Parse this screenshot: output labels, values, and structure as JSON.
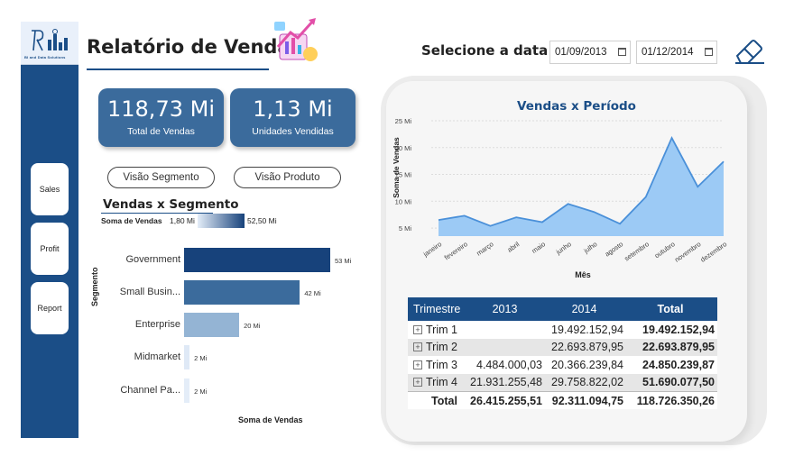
{
  "header": {
    "title": "Relatório de Vendas"
  },
  "sidebar": {
    "logo_text": "BI and Data Solutions",
    "items": [
      {
        "label": "Sales"
      },
      {
        "label": "Profit"
      },
      {
        "label": "Report"
      }
    ]
  },
  "filters": {
    "label": "Selecione a data",
    "start_date": "01/09/2013",
    "end_date": "01/12/2014"
  },
  "kpis": [
    {
      "value": "118,73 Mi",
      "label": "Total de Vendas"
    },
    {
      "value": "1,13 Mi",
      "label": "Unidades Vendidas"
    }
  ],
  "toggles": {
    "segment": "Visão Segmento",
    "product": "Visão Produto"
  },
  "colors": {
    "primary": "#1b4e87",
    "kpi": "#3b6b9c",
    "area": "#9ccaf5",
    "line": "#4a90d9"
  },
  "segment_chart": {
    "title": "Vendas x Segmento",
    "legend_label": "Soma de Vendas",
    "legend_min": "1,80 Mi",
    "legend_max": "52,50 Mi",
    "y_axis_label": "Segmento",
    "x_axis_label": "Soma de Vendas"
  },
  "line_chart": {
    "title": "Vendas x Período",
    "y_axis_label": "Soma de Vendas",
    "x_axis_label": "Mês"
  },
  "chart_data": [
    {
      "type": "bar",
      "orientation": "horizontal",
      "title": "Vendas x Segmento",
      "xlabel": "Soma de Vendas",
      "ylabel": "Segmento",
      "categories": [
        "Government",
        "Small Busin...",
        "Enterprise",
        "Midmarket",
        "Channel Pa..."
      ],
      "values": [
        53,
        42,
        20,
        2,
        2
      ],
      "value_labels": [
        "53 Mi",
        "42 Mi",
        "20 Mi",
        "2 Mi",
        "2 Mi"
      ],
      "colors": [
        "#17427b",
        "#3b6b9c",
        "#94b4d4",
        "#dfe9f6",
        "#e4edf8"
      ],
      "xlim": [
        0,
        53
      ],
      "grid": false
    },
    {
      "type": "area",
      "title": "Vendas x Período",
      "xlabel": "Mês",
      "ylabel": "Soma de Vendas",
      "x": [
        "janeiro",
        "fevereiro",
        "março",
        "abril",
        "maio",
        "junho",
        "julho",
        "agosto",
        "setembro",
        "outubro",
        "novembro",
        "dezembro"
      ],
      "values": [
        6.5,
        7.3,
        5.4,
        7,
        6.1,
        9.5,
        8,
        5.8,
        10.8,
        21.8,
        12.7,
        17.4
      ],
      "y_ticks": [
        "5 Mi",
        "10 Mi",
        "15 Mi",
        "20 Mi",
        "25 Mi"
      ],
      "ylim": [
        3.5,
        25
      ],
      "grid": true
    }
  ],
  "table": {
    "headers": [
      "Trimestre",
      "2013",
      "2014",
      "Total"
    ],
    "rows": [
      {
        "label": "Trim 1",
        "y2013": "",
        "y2014": "19.492.152,94",
        "total": "19.492.152,94"
      },
      {
        "label": "Trim 2",
        "y2013": "",
        "y2014": "22.693.879,95",
        "total": "22.693.879,95"
      },
      {
        "label": "Trim 3",
        "y2013": "4.484.000,03",
        "y2014": "20.366.239,84",
        "total": "24.850.239,87"
      },
      {
        "label": "Trim 4",
        "y2013": "21.931.255,48",
        "y2014": "29.758.822,02",
        "total": "51.690.077,50"
      }
    ],
    "footer": {
      "label": "Total",
      "y2013": "26.415.255,51",
      "y2014": "92.311.094,75",
      "total": "118.726.350,26"
    }
  }
}
